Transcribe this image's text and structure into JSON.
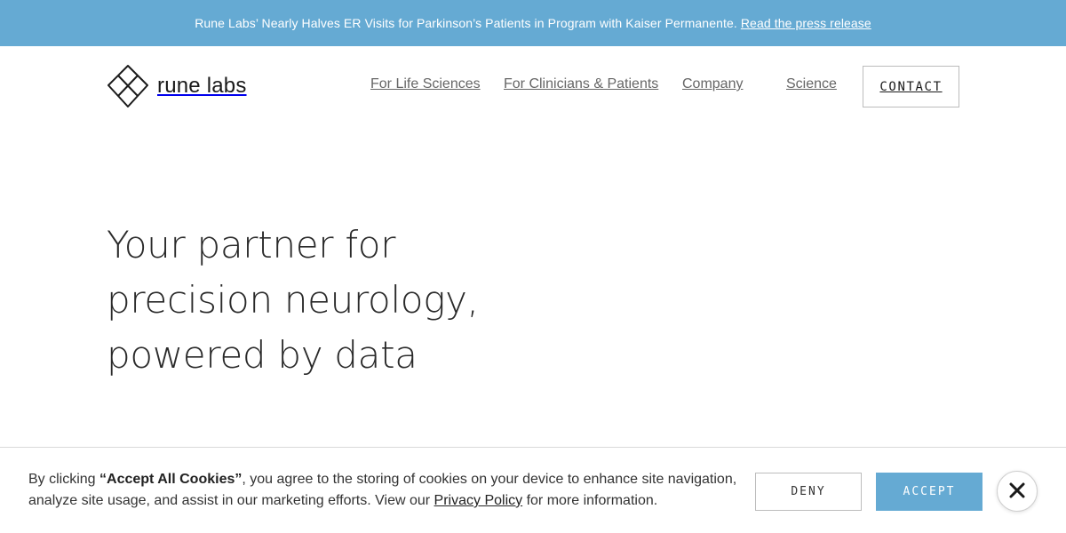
{
  "announcement": {
    "message": "Rune Labs’ Nearly Halves ER Visits for Parkinson’s Patients in Program with Kaiser Permanente.",
    "link_label": "Read the press release"
  },
  "header": {
    "logo_text": "rune labs",
    "logo_icon": "rune-logo-icon",
    "nav": [
      {
        "label": "For Life Sciences"
      },
      {
        "label": "For Clinicians & Patients"
      },
      {
        "label": "Company"
      },
      {
        "label": "Science"
      }
    ],
    "contact_label": "CONTACT"
  },
  "hero": {
    "lines": [
      "Your partner for",
      "precision neurology,",
      "powered by data"
    ]
  },
  "cookie_banner": {
    "text_before": "By clicking ",
    "text_bold": "“Accept All Cookies”",
    "text_middle": ", you agree to the storing of cookies on your device to enhance site navigation, analyze site usage, and assist in our marketing efforts. View our ",
    "privacy_link": "Privacy Policy",
    "text_after": " for more information.",
    "deny_label": "DENY",
    "accept_label": "ACCEPT",
    "close_icon": "close-icon"
  },
  "colors": {
    "accent": "#65aad3",
    "text": "#2a2a2a",
    "nav_text": "#666666"
  }
}
